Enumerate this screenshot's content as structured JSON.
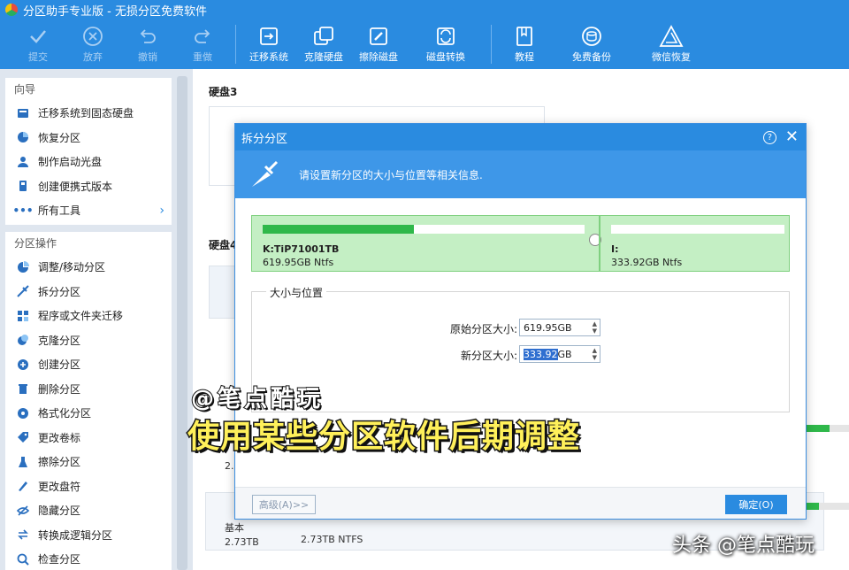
{
  "window": {
    "title": "分区助手专业版 - 无损分区免费软件"
  },
  "toolbar": {
    "commit": "提交",
    "discard": "放弃",
    "undo": "撤销",
    "redo": "重做",
    "migrate_os": "迁移系统",
    "clone_disk": "克隆硬盘",
    "wipe_disk": "擦除磁盘",
    "disk_convert": "磁盘转换",
    "tutorial": "教程",
    "free_backup": "免费备份",
    "wechat_restore": "微信恢复"
  },
  "sidebar": {
    "wizard_title": "向导",
    "wizard_items": [
      {
        "label": "迁移系统到固态硬盘",
        "icon": "migrate-icon"
      },
      {
        "label": "恢复分区",
        "icon": "restore-icon"
      },
      {
        "label": "制作启动光盘",
        "icon": "boot-disc-icon"
      },
      {
        "label": "创建便携式版本",
        "icon": "portable-icon"
      },
      {
        "label": "所有工具",
        "icon": "more-icon"
      }
    ],
    "ops_title": "分区操作",
    "ops_items": [
      {
        "label": "调整/移动分区",
        "icon": "resize-icon"
      },
      {
        "label": "拆分分区",
        "icon": "split-icon"
      },
      {
        "label": "程序或文件夹迁移",
        "icon": "app-move-icon"
      },
      {
        "label": "克隆分区",
        "icon": "clone-icon"
      },
      {
        "label": "创建分区",
        "icon": "create-icon"
      },
      {
        "label": "删除分区",
        "icon": "delete-icon"
      },
      {
        "label": "格式化分区",
        "icon": "format-icon"
      },
      {
        "label": "更改卷标",
        "icon": "label-icon"
      },
      {
        "label": "擦除分区",
        "icon": "wipe-icon"
      },
      {
        "label": "更改盘符",
        "icon": "letter-icon"
      },
      {
        "label": "隐藏分区",
        "icon": "hide-icon"
      },
      {
        "label": "转换成逻辑分区",
        "icon": "convert-icon"
      },
      {
        "label": "检查分区",
        "icon": "check-icon"
      }
    ]
  },
  "main": {
    "disk3_label": "硬盘3",
    "disk4_label": "硬盘4",
    "row_a_size": "2.7",
    "row_b_type": "基本",
    "row_b_size": "2.73TB",
    "row_b_fs": "2.73TB NTFS"
  },
  "dialog": {
    "title": "拆分分区",
    "banner": "请设置新分区的大小与位置等相关信息.",
    "left_partition": {
      "name": "K:TiP71001TB",
      "size": "619.95GB Ntfs",
      "used_fraction": 0.47
    },
    "right_partition": {
      "name": "I:",
      "size": "333.92GB Ntfs",
      "used_fraction": 0.0
    },
    "group_title": "大小与位置",
    "orig_label": "原始分区大小:",
    "orig_value": "619.95GB",
    "new_label": "新分区大小:",
    "new_value_selected": "333.92",
    "new_value_unit": "GB",
    "advanced_button": "高级(A)>>",
    "ok_button": "确定(O)"
  },
  "overlay": {
    "handle": "@笔点酷玩",
    "caption": "使用某些分区软件后期调整",
    "watermark": "头条 @笔点酷玩"
  },
  "colors": {
    "accent": "#2a8be0",
    "partition_green": "#c4efc4",
    "usage_green": "#2fb84a",
    "caption_yellow": "#fff05a"
  }
}
